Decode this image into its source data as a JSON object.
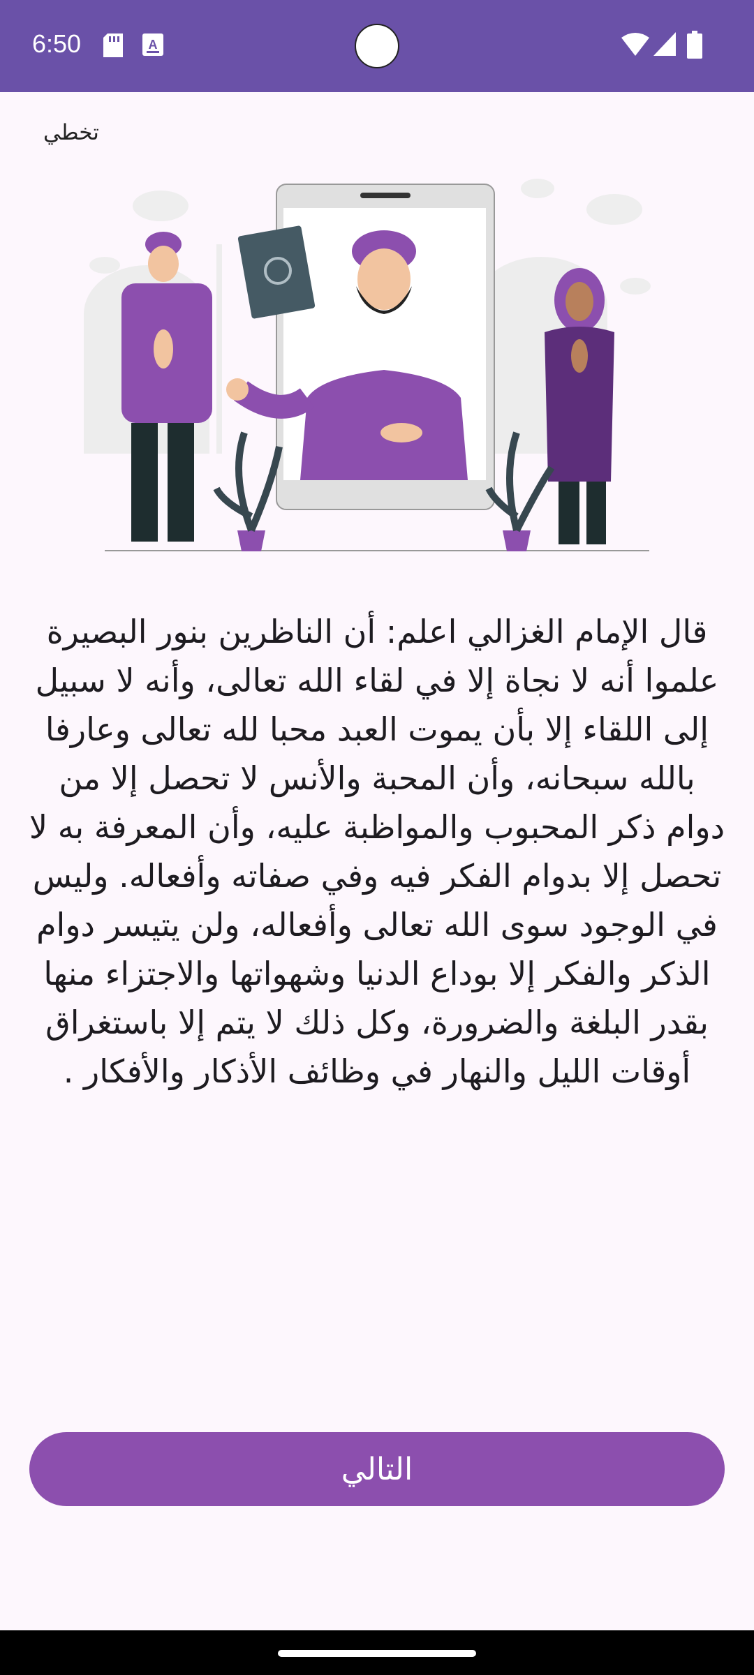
{
  "status_bar": {
    "time": "6:50",
    "left_icons": [
      "sd-card-icon",
      "keyboard-a-icon"
    ],
    "right_icons": [
      "wifi-icon",
      "signal-icon",
      "battery-icon"
    ],
    "background_color": "#6A51A8"
  },
  "skip_label": "تخطي",
  "illustration": {
    "description_icons": [
      "mosque-icon",
      "phone-icon",
      "quran-book-icon",
      "man-icon",
      "imam-icon",
      "woman-icon",
      "plant-icon"
    ]
  },
  "quote": "قال الإمام الغزالي اعلم: أن الناظرين بنور البصيرة علموا أنه لا نجاة إلا في لقاء الله تعالى، وأنه لا سبيل إلى اللقاء إلا بأن يموت العبد محبا لله تعالى وعارفا بالله سبحانه، وأن المحبة والأنس لا تحصل إلا من دوام ذكر المحبوب والمواظبة عليه، وأن المعرفة به لا تحصل إلا بدوام الفكر فيه وفي صفاته وأفعاله. وليس في الوجود سوى الله تعالى وأفعاله، ولن يتيسر دوام الذكر والفكر إلا بوداع الدنيا وشهواتها والاجتزاء منها بقدر البلغة والضرورة، وكل ذلك لا يتم إلا باستغراق أوقات الليل والنهار في وظائف الأذكار والأفكار .",
  "next_button_label": "التالي",
  "colors": {
    "accent": "#8C4FAE",
    "background": "#FDF7FD"
  }
}
